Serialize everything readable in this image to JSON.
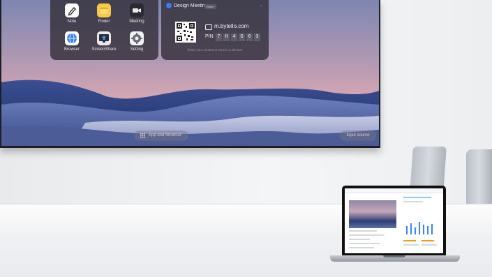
{
  "display": {
    "apps": [
      {
        "label": "Note",
        "icon": "note-icon",
        "color": "#ffffff"
      },
      {
        "label": "Finder",
        "icon": "finder-icon",
        "color": "#f7c948"
      },
      {
        "label": "Meeting",
        "icon": "meeting-icon",
        "color": "#2a2a30"
      },
      {
        "label": "Browser",
        "icon": "browser-icon",
        "color": "#3b82f6"
      },
      {
        "label": "ScreenShare",
        "icon": "screenshare-icon",
        "color": "#2d2f3a"
      },
      {
        "label": "Setting",
        "icon": "setting-icon",
        "color": "#f2f2f4"
      }
    ],
    "meeting": {
      "title": "Design Meeting",
      "tag": "Share",
      "url": "m.bytello.com",
      "pin_label": "PIN",
      "pin": [
        "7",
        "H",
        "4",
        "G",
        "6",
        "3"
      ],
      "share_hint": "Share your content or screen to devices"
    },
    "dock": {
      "apps_button": "App and Shortcut",
      "input_button": "Input source"
    }
  },
  "colors": {
    "panel_bg": "#34303a",
    "accent": "#3d7cf4"
  }
}
